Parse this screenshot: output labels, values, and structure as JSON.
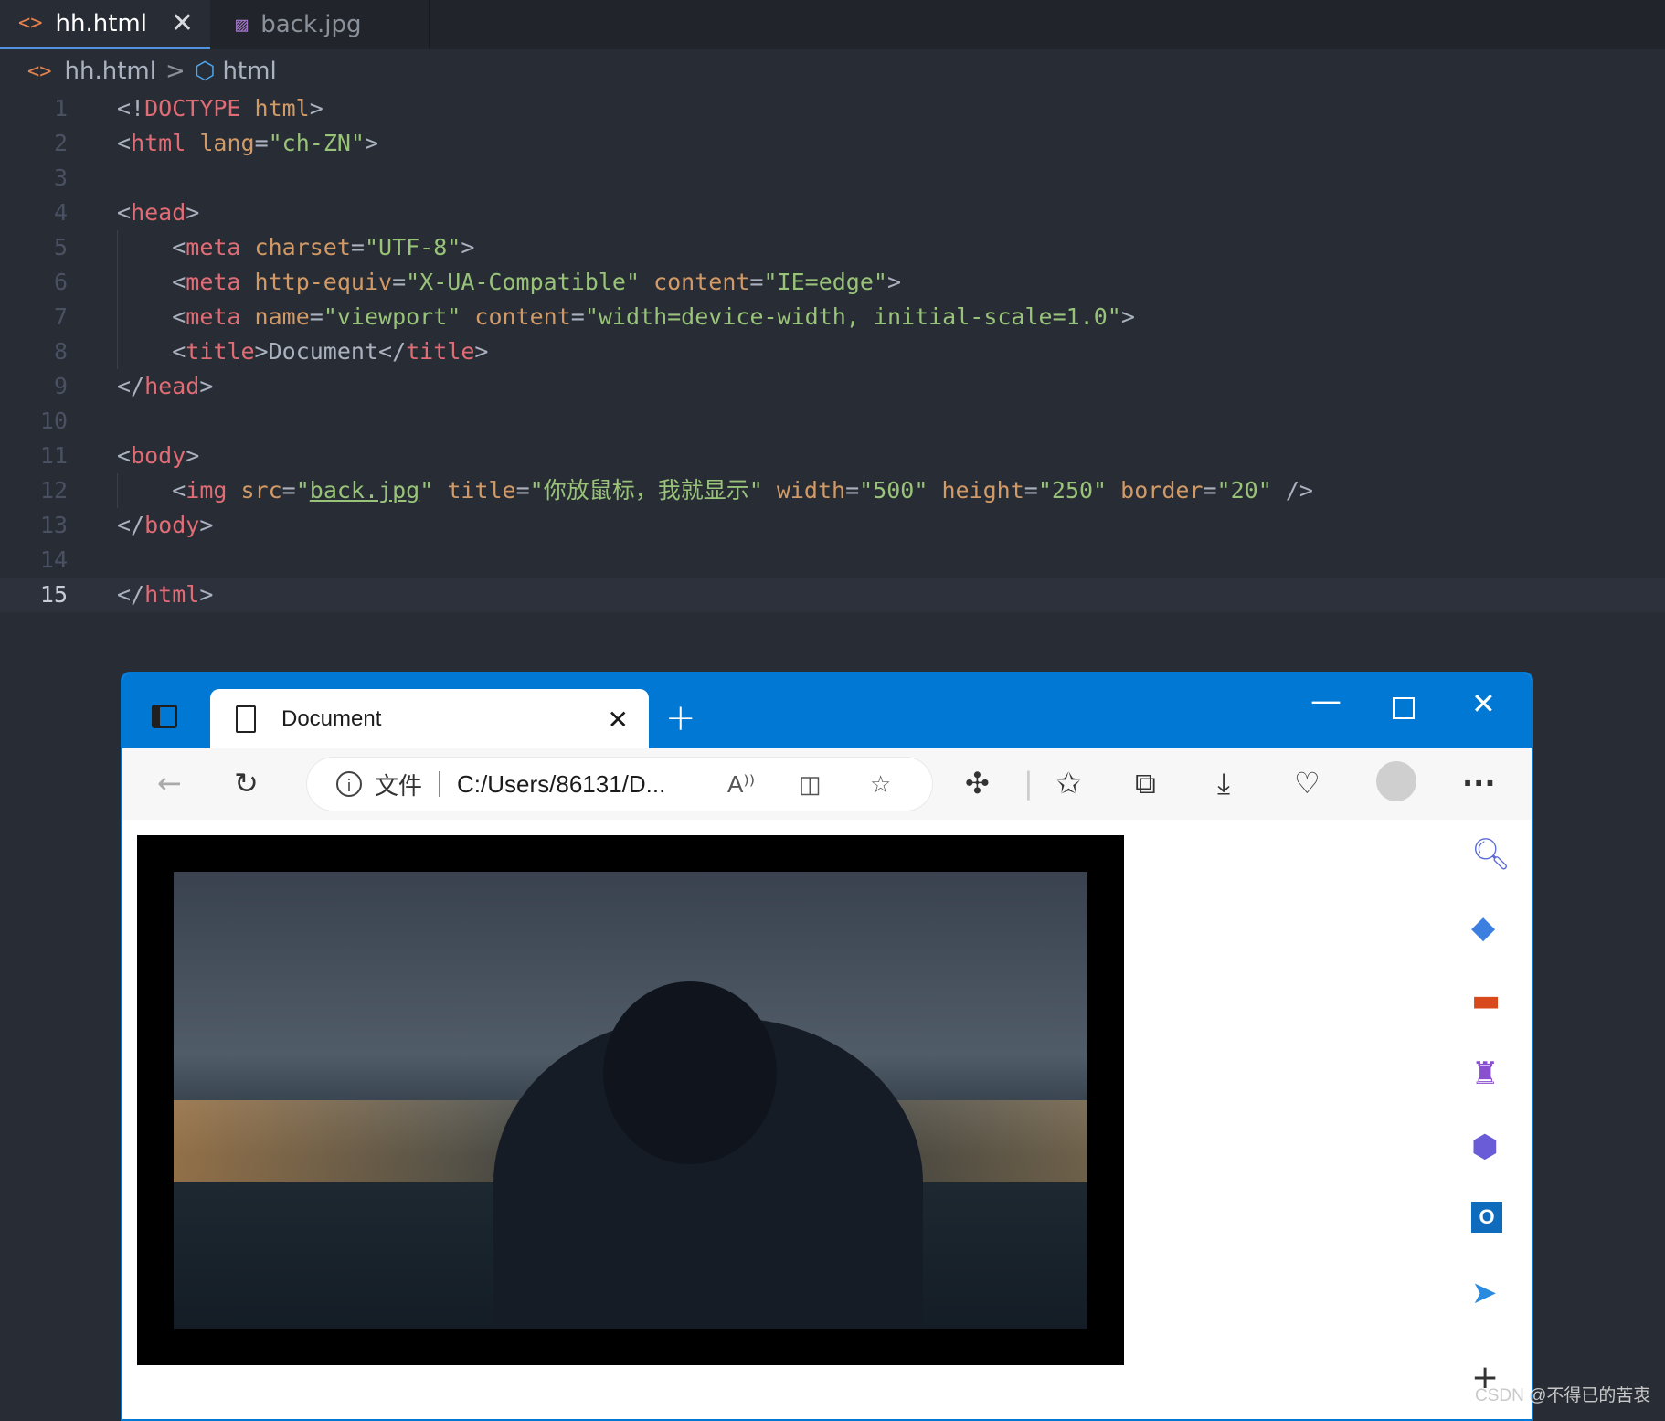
{
  "editor": {
    "tabs": [
      {
        "label": "hh.html",
        "icon": "html-file-icon",
        "active": true
      },
      {
        "label": "back.jpg",
        "icon": "image-file-icon",
        "active": false
      }
    ],
    "breadcrumb": {
      "file": "hh.html",
      "separator": ">",
      "element": "html"
    },
    "lines": [
      {
        "n": "1"
      },
      {
        "n": "2"
      },
      {
        "n": "3"
      },
      {
        "n": "4"
      },
      {
        "n": "5"
      },
      {
        "n": "6"
      },
      {
        "n": "7"
      },
      {
        "n": "8"
      },
      {
        "n": "9"
      },
      {
        "n": "10"
      },
      {
        "n": "11"
      },
      {
        "n": "12"
      },
      {
        "n": "13"
      },
      {
        "n": "14"
      },
      {
        "n": "15"
      }
    ],
    "code": {
      "l1": {
        "lt": "<!",
        "doctype": "DOCTYPE",
        "html": " html",
        "gt": ">"
      },
      "l2": {
        "tag": "html",
        "attr": "lang",
        "val": "\"ch-ZN\""
      },
      "l4": {
        "tag": "head"
      },
      "l5": {
        "tag": "meta",
        "attr": "charset",
        "val": "\"UTF-8\""
      },
      "l6": {
        "tag": "meta",
        "attr1": "http-equiv",
        "val1": "\"X-UA-Compatible\"",
        "attr2": "content",
        "val2": "\"IE=edge\""
      },
      "l7": {
        "tag": "meta",
        "attr1": "name",
        "val1": "\"viewport\"",
        "attr2": "content",
        "val2": "\"width=device-width, initial-scale=1.0\""
      },
      "l8": {
        "tag": "title",
        "text": "Document"
      },
      "l9": {
        "tag": "head"
      },
      "l11": {
        "tag": "body"
      },
      "l12": {
        "tag": "img",
        "a1": "src",
        "v1": "back.jpg",
        "a2": "title",
        "v2": "\"你放鼠标，我就显示\"",
        "a3": "width",
        "v3": "\"500\"",
        "a4": "height",
        "v4": "\"250\"",
        "a5": "border",
        "v5": "\"20\""
      },
      "l13": {
        "tag": "body"
      },
      "l15": {
        "tag": "html"
      }
    },
    "colors": {
      "background": "#282c34",
      "tag": "#e06c75",
      "attribute": "#d19a66",
      "string": "#98c379",
      "punct": "#abb2bf"
    }
  },
  "browser": {
    "tab_title": "Document",
    "new_tab": "+",
    "address_scheme": "文件",
    "address_url": "C:/Users/86131/D...",
    "accent": "#0078d4",
    "toolbar_icons": [
      "back-icon",
      "refresh-icon",
      "read-aloud-icon",
      "split-screen-icon",
      "favorite-star-icon",
      "extensions-icon",
      "favorites-icon",
      "collections-icon",
      "download-icon",
      "browser-essentials-icon",
      "profile-icon",
      "more-icon"
    ],
    "sidebar_icons": [
      "search-icon",
      "shopping-tag-icon",
      "tools-icon",
      "games-icon",
      "microsoft365-icon",
      "outlook-icon",
      "send-icon",
      "add-icon"
    ],
    "labels": {
      "read_aloud": "A⁾⁾",
      "more": "···",
      "outlook": "O"
    }
  },
  "watermark": "CSDN @不得已的苦衷"
}
